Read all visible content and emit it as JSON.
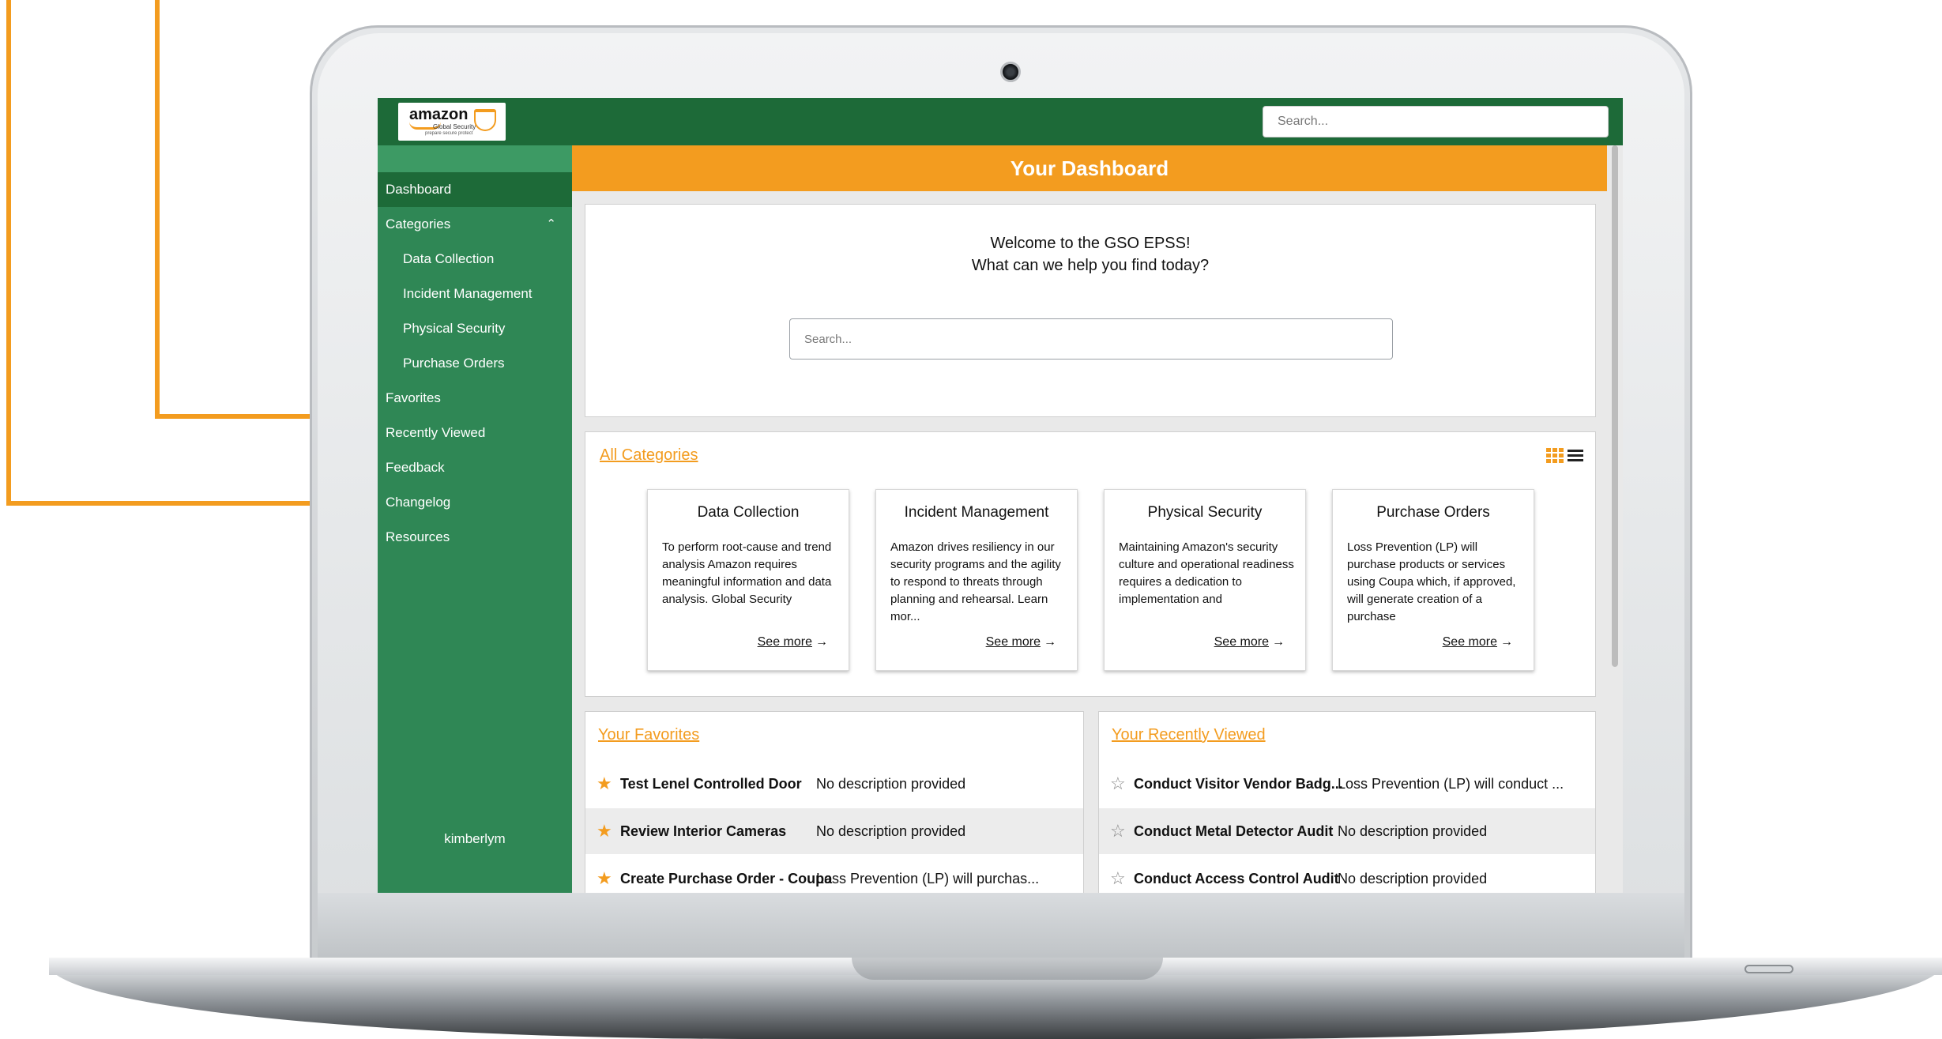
{
  "window": {
    "title": "GSO EPSS"
  },
  "brand": {
    "logo_text": "amazon",
    "logo_subtitle": "Global Security",
    "logo_tagline": "prepare secure protect"
  },
  "header": {
    "search_placeholder": "Search..."
  },
  "sidebar": {
    "items": [
      {
        "label": "Dashboard",
        "active": true
      },
      {
        "label": "Categories",
        "expanded": true
      },
      {
        "label": "Data Collection"
      },
      {
        "label": "Incident Management"
      },
      {
        "label": "Physical Security"
      },
      {
        "label": "Purchase Orders"
      },
      {
        "label": "Favorites"
      },
      {
        "label": "Recently Viewed"
      },
      {
        "label": "Feedback"
      },
      {
        "label": "Changelog"
      },
      {
        "label": "Resources"
      }
    ],
    "user": "kimberlym"
  },
  "main": {
    "title": "Your Dashboard",
    "welcome_line1": "Welcome to the GSO EPSS!",
    "welcome_line2": "What can we help you find today?",
    "search_placeholder": "Search...",
    "all_categories": "All Categories",
    "see_more": "See more",
    "cards": [
      {
        "title": "Data Collection",
        "description": "To perform root-cause and trend analysis Amazon requires meaningful information and data analysis. Global Security"
      },
      {
        "title": "Incident Management",
        "description": "Amazon drives resiliency in our security programs and the agility to respond to threats through planning and rehearsal. Learn mor..."
      },
      {
        "title": "Physical Security",
        "description": "Maintaining Amazon's security culture and operational readiness requires a dedication to implementation and"
      },
      {
        "title": "Purchase Orders",
        "description": "Loss Prevention (LP) will purchase products or services using Coupa which, if approved, will generate creation of a purchase"
      }
    ],
    "favorites": {
      "heading": "Your Favorites",
      "rows": [
        {
          "title": "Test Lenel Controlled Door",
          "description": "No description provided"
        },
        {
          "title": "Review Interior Cameras",
          "description": "No description provided"
        },
        {
          "title": "Create Purchase Order - Coupa",
          "description": "Loss Prevention (LP) will purchas..."
        }
      ]
    },
    "recent": {
      "heading": "Your Recently Viewed",
      "rows": [
        {
          "title": "Conduct Visitor Vendor Badg...",
          "description": "Loss Prevention (LP) will conduct ..."
        },
        {
          "title": "Conduct Metal Detector Audit",
          "description": "No description provided"
        },
        {
          "title": "Conduct Access Control Audit",
          "description": "No description provided"
        }
      ]
    }
  },
  "colors": {
    "accent": "#f39c1f",
    "primary_green": "#1d6a38",
    "sidebar_green": "#2f8755"
  },
  "icons": {
    "favorite": "star-filled-icon",
    "recent": "star-outline-icon",
    "grid_view": "grid-icon",
    "list_view": "list-icon",
    "collapse": "chevron-up-icon",
    "see_more": "arrow-right-icon"
  }
}
